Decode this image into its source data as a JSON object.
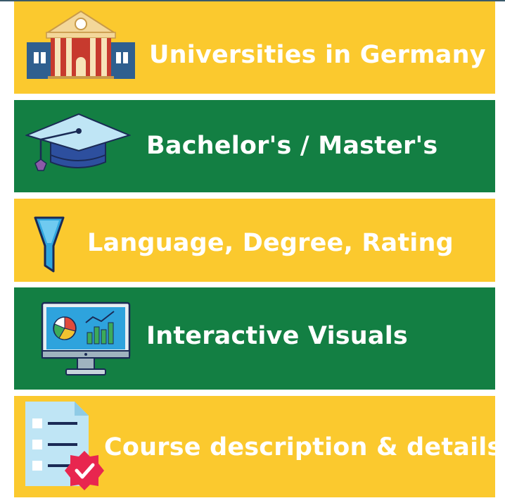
{
  "colors": {
    "yellow": "#fbc92e",
    "green": "#137f43",
    "text": "#ffffff"
  },
  "banners": [
    {
      "label": "Universities in Germany",
      "icon": "university-building-icon",
      "color": "yellow"
    },
    {
      "label": "Bachelor's / Master's",
      "icon": "graduation-cap-icon",
      "color": "green"
    },
    {
      "label": "Language, Degree, Rating",
      "icon": "filter-funnel-icon",
      "color": "yellow"
    },
    {
      "label": "Interactive Visuals",
      "icon": "dashboard-monitor-icon",
      "color": "green"
    },
    {
      "label": "Course description & details",
      "icon": "checklist-document-icon",
      "color": "yellow"
    }
  ]
}
